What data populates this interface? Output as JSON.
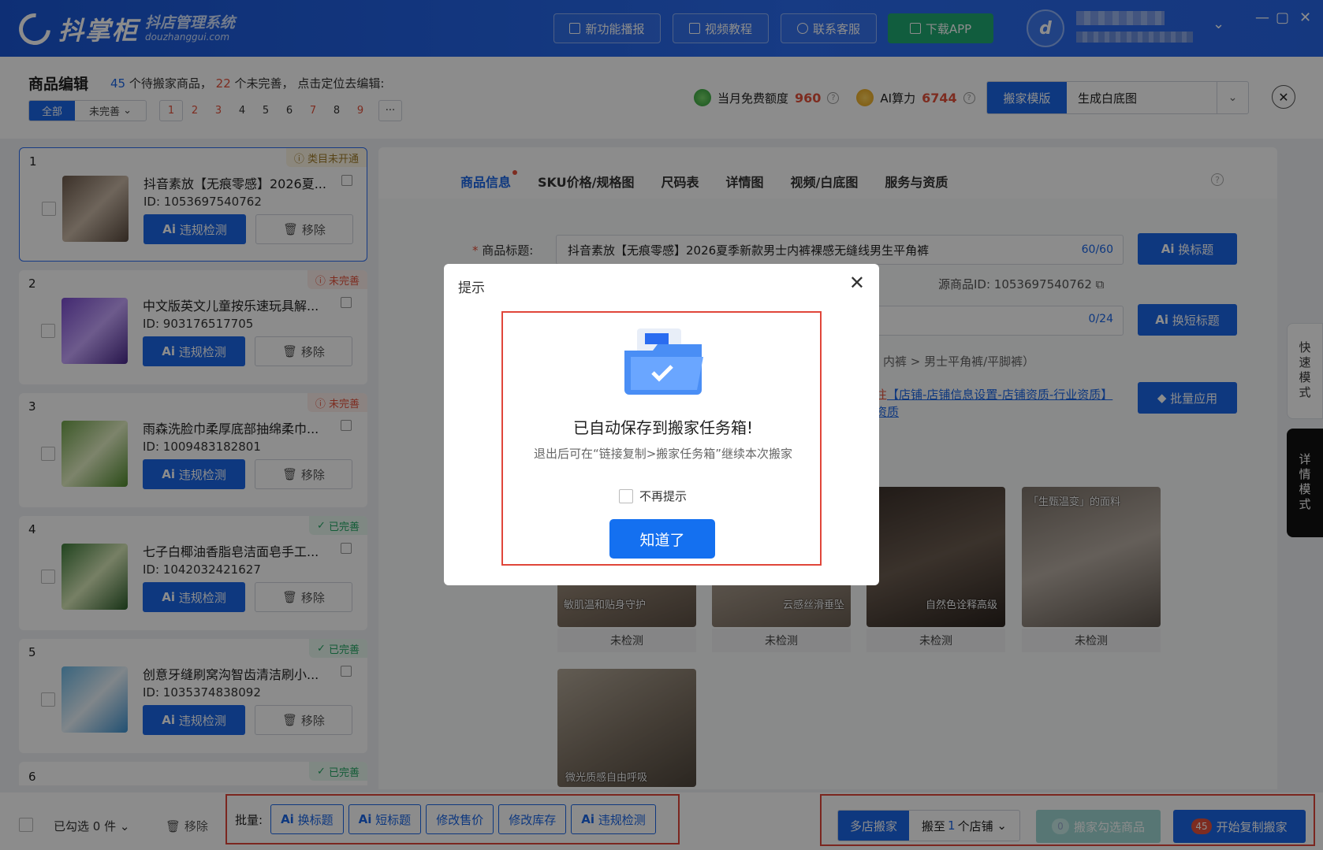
{
  "app": {
    "logo_text": "抖掌柜",
    "logo_sub": "抖店管理系统",
    "logo_url": "douzhanggui.com",
    "avatar_letter": "d",
    "buttons": [
      "新功能播报",
      "视频教程",
      "联系客服",
      "下载APP"
    ]
  },
  "header": {
    "title": "商品编辑",
    "count_total": "45",
    "text1": "个待搬家商品，",
    "count_incomplete": "22",
    "text2": "个未完善， 点击定位去编辑:",
    "filter_all": "全部",
    "filter_incomplete": "未完善",
    "pages": [
      "1",
      "2",
      "3",
      "4",
      "5",
      "6",
      "7",
      "8",
      "9"
    ],
    "more": "···",
    "quota_label": "当月免费额度",
    "quota_value": "960",
    "ai_label": "AI算力",
    "ai_value": "6744",
    "mode_label": "搬家模版",
    "mode_value": "生成白底图"
  },
  "products": [
    {
      "index": "1",
      "name": "抖音素放【无痕零感】2026夏...",
      "id": "ID:  1053697540762",
      "badge": "类目未开通",
      "status": "warn"
    },
    {
      "index": "2",
      "name": "中文版英文儿童按乐速玩具解...",
      "id": "ID:  903176517705",
      "badge": "未完善",
      "status": "red"
    },
    {
      "index": "3",
      "name": "雨森洗脸巾柔厚底部抽绵柔巾...",
      "id": "ID:  1009483182801",
      "badge": "未完善",
      "status": "red"
    },
    {
      "index": "4",
      "name": "七子白椰油香脂皂洁面皂手工...",
      "id": "ID:  1042032421627",
      "badge": "已完善",
      "status": "ok"
    },
    {
      "index": "5",
      "name": "创意牙缝刷窝沟智齿清洁刷小...",
      "id": "ID:  1035374838092",
      "badge": "已完善",
      "status": "ok"
    },
    {
      "index": "6",
      "name": "",
      "id": "",
      "badge": "已完善",
      "status": "ok"
    }
  ],
  "card_actions": {
    "check": "违规检测",
    "remove": "移除"
  },
  "tabs": [
    "商品信息",
    "SKU价格/规格图",
    "尺码表",
    "详情图",
    "视频/白底图",
    "服务与资质"
  ],
  "form": {
    "title_label": "商品标题:",
    "title_value": "抖音素放【无痕零感】2026夏季新款男士内裤裸感无缝线男生平角裤",
    "title_count": "60/60",
    "short_count": "0/24",
    "source_label": "源商品ID:  1053697540762",
    "category_text": "内裤 > 男士平角裤/平脚裤）",
    "link_prefix": "往",
    "link_text": "【店铺-店铺信息设置-店铺资质-行业资质】",
    "link_end": "资质",
    "btn_title": "换标题",
    "btn_short": "换短标题",
    "btn_batch": "批量应用"
  },
  "images": [
    {
      "caption": "敏肌温和贴身守护",
      "status": "未检测"
    },
    {
      "caption": "云感丝滑垂坠",
      "status": "未检测"
    },
    {
      "caption": "自然色诠释高级",
      "status": "未检测"
    },
    {
      "caption": "「生甄温变」的面料",
      "status": "未检测"
    },
    {
      "caption": "微光质感自由呼吸",
      "status": "未检测"
    }
  ],
  "side": {
    "quick": "快速模式",
    "detail": "详情模式"
  },
  "dialog": {
    "title": "提示",
    "heading": "已自动保存到搬家任务箱!",
    "desc": "退出后可在“链接复制>搬家任务箱”继续本次搬家",
    "checkbox": "不再提示",
    "button": "知道了"
  },
  "bottom": {
    "selected": "已勾选 0 件",
    "remove": "移除",
    "batch_label": "批量:",
    "batch_buttons": [
      "换标题",
      "短标题",
      "修改售价",
      "修改库存",
      "违规检测"
    ],
    "multi_label": "多店搬家",
    "move_to_pre": "搬至",
    "move_to_num": "1",
    "move_to_post": "个店铺",
    "pick_count": "0",
    "pick_label": "搬家勾选商品",
    "start_count": "45",
    "start_label": "开始复制搬家"
  },
  "colors": {
    "primary": "#1a66e8",
    "danger": "#e4513b",
    "success": "#23a764",
    "topbar": "#2a6cf0"
  }
}
